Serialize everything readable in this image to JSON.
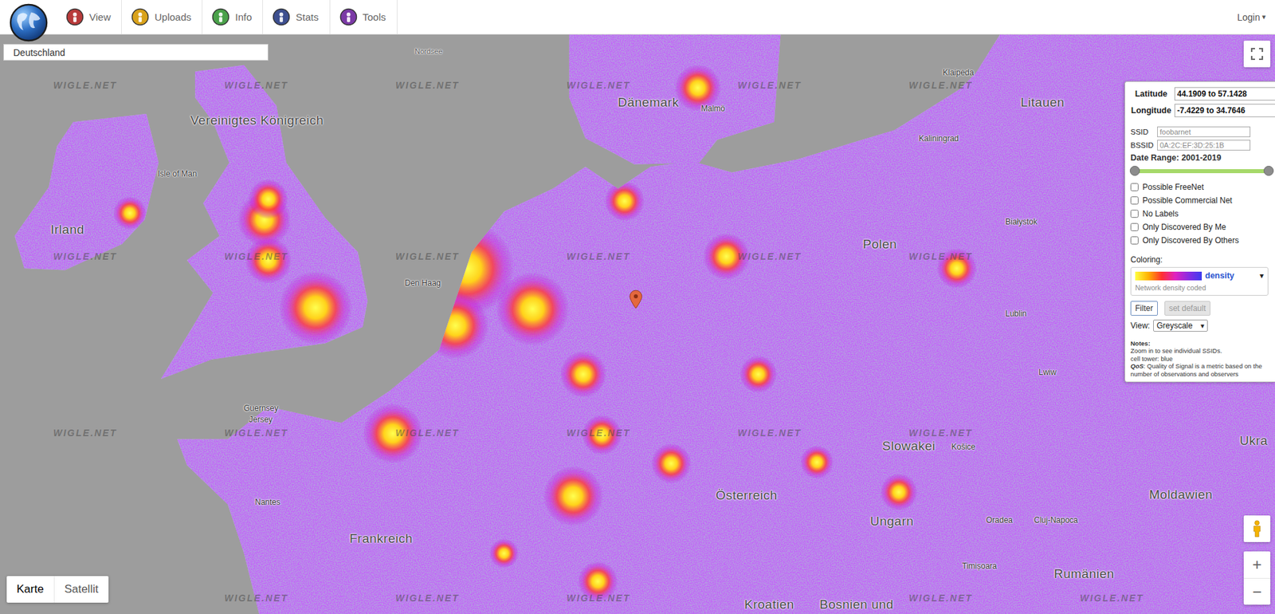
{
  "nav": {
    "items": [
      {
        "label": "View",
        "color": "#b83a3a"
      },
      {
        "label": "Uploads",
        "color": "#d9a21b"
      },
      {
        "label": "Info",
        "color": "#4aa14a"
      },
      {
        "label": "Stats",
        "color": "#3d4f8f"
      },
      {
        "label": "Tools",
        "color": "#7b3aa6"
      }
    ],
    "login": {
      "label": "Login",
      "caret": "▾"
    }
  },
  "search": {
    "value": "Deutschland"
  },
  "map": {
    "watermark": "WIGLE.NET",
    "labels": [
      {
        "text": "Nordsee",
        "kind": "sea"
      },
      {
        "text": "Vereinigtes Königreich",
        "kind": "country"
      },
      {
        "text": "Isle of Man",
        "kind": "city"
      },
      {
        "text": "Irland",
        "kind": "country"
      },
      {
        "text": "Den Haag",
        "kind": "city"
      },
      {
        "text": "Guernsey",
        "kind": "city"
      },
      {
        "text": "Jersey",
        "kind": "city"
      },
      {
        "text": "Nantes",
        "kind": "city"
      },
      {
        "text": "Frankreich",
        "kind": "country"
      },
      {
        "text": "Dänemark",
        "kind": "country"
      },
      {
        "text": "Malmö",
        "kind": "city"
      },
      {
        "text": "Klaipėda",
        "kind": "city"
      },
      {
        "text": "Litauen",
        "kind": "country"
      },
      {
        "text": "Kaliningrad",
        "kind": "city"
      },
      {
        "text": "Białystok",
        "kind": "city"
      },
      {
        "text": "Polen",
        "kind": "country"
      },
      {
        "text": "Lublin",
        "kind": "city"
      },
      {
        "text": "Lwiw",
        "kind": "city"
      },
      {
        "text": "Slowakei",
        "kind": "country"
      },
      {
        "text": "Košice",
        "kind": "city"
      },
      {
        "text": "Österreich",
        "kind": "country"
      },
      {
        "text": "Ungarn",
        "kind": "country"
      },
      {
        "text": "Oradea",
        "kind": "city"
      },
      {
        "text": "Cluj-Napoca",
        "kind": "city"
      },
      {
        "text": "Moldawien",
        "kind": "country"
      },
      {
        "text": "Timișoara",
        "kind": "city"
      },
      {
        "text": "Rumänien",
        "kind": "country"
      },
      {
        "text": "Kroatien",
        "kind": "country"
      },
      {
        "text": "Bosnien und",
        "kind": "country"
      },
      {
        "text": "Ukra",
        "kind": "country"
      }
    ],
    "type_toggle": [
      {
        "label": "Karte",
        "selected": true
      },
      {
        "label": "Satellit",
        "selected": false
      }
    ],
    "zoom": {
      "in": "+",
      "out": "−"
    }
  },
  "filter_panel": {
    "latitude": {
      "label": "Latitude",
      "value": "44.1909 to 57.1428"
    },
    "longitude": {
      "label": "Longitude",
      "value": "-7.4229 to 34.7646"
    },
    "ssid": {
      "label": "SSID",
      "placeholder": "foobarnet"
    },
    "bssid": {
      "label": "BSSID",
      "placeholder": "0A:2C:EF:3D:25:1B"
    },
    "date_range": {
      "label": "Date Range: 2001-2019",
      "start": 0,
      "level": 1
    },
    "checkboxes": [
      {
        "label": "Possible FreeNet",
        "checked": false
      },
      {
        "label": "Possible Commercial Net",
        "checked": false
      },
      {
        "label": "No Labels",
        "checked": false
      },
      {
        "label": "Only Discovered By Me",
        "checked": false
      },
      {
        "label": "Only Discovered By Others",
        "checked": false
      }
    ],
    "coloring": {
      "label": "Coloring:",
      "value": "density",
      "caret": "▾",
      "description": "Network density coded"
    },
    "buttons": [
      {
        "label": "Filter",
        "disabled": false
      },
      {
        "label": "set default",
        "disabled": true
      }
    ],
    "view": {
      "label": "View:",
      "value": "Greyscale",
      "caret": "▾"
    },
    "notes": {
      "title": "Notes:",
      "lines": [
        "Zoom in to see individual SSIDs.",
        "cell tower: blue"
      ],
      "qos_term": "QoS",
      "qos_text": ": Quality of Signal is a metric based on the number of observations and observers"
    }
  }
}
